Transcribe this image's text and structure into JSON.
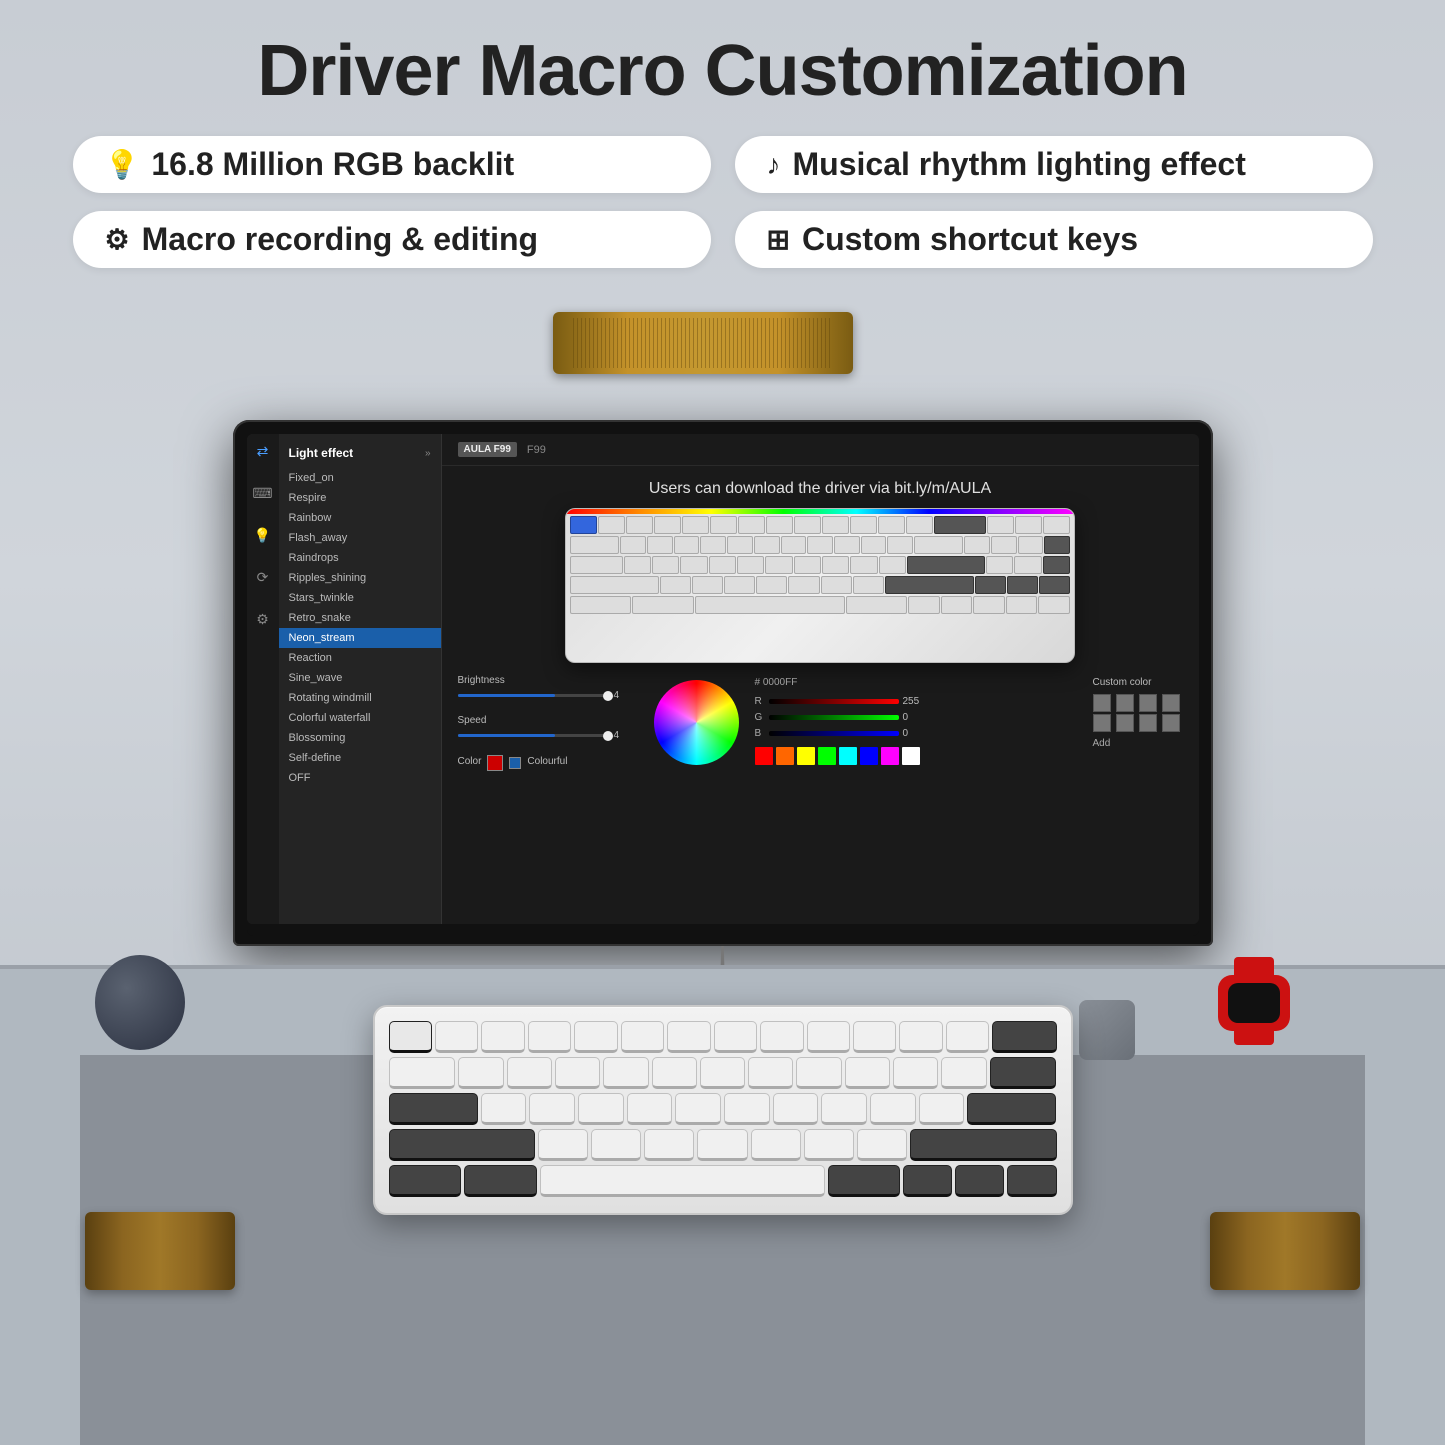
{
  "page": {
    "title": "Driver Macro Customization",
    "badge1": "16.8 Million RGB backlit",
    "badge2": "Macro recording & editing",
    "badge3": "Musical rhythm lighting effect",
    "badge4": "Custom shortcut keys",
    "icon1": "💡",
    "icon2": "⚙",
    "icon3": "♪",
    "icon4": "⊞"
  },
  "screen": {
    "tag": "AULA F99",
    "download_text": "Users can download the driver via bit.ly/m/AULA",
    "sidebar_title": "Light effect",
    "menu_items": [
      "Fixed_on",
      "Respire",
      "Rainbow",
      "Flash_away",
      "Raindrops",
      "Ripples_shining",
      "Stars_twinkle",
      "Retro_snake",
      "Neon_stream",
      "Reaction",
      "Sine_wave",
      "Rotating windmill",
      "Colorful waterfall",
      "Blossoming",
      "Self-define",
      "OFF"
    ],
    "active_item": "Neon_stream",
    "brightness_label": "Brightness",
    "brightness_value": "4",
    "speed_label": "Speed",
    "speed_value": "4",
    "color_label": "Color",
    "colorful_label": "Colourful",
    "hex_label": "# 0000FF",
    "r_val": "255",
    "g_val": "0",
    "b_val": "0",
    "custom_color_label": "Custom color",
    "add_label": "Add"
  },
  "swatches": [
    "#ff0000",
    "#ff6600",
    "#ffff00",
    "#00ff00",
    "#00ffff",
    "#0000ff",
    "#ff00ff",
    "#ffffff"
  ],
  "custom_cells": [
    "#888",
    "#888",
    "#888",
    "#888",
    "#888",
    "#888",
    "#888",
    "#888"
  ]
}
